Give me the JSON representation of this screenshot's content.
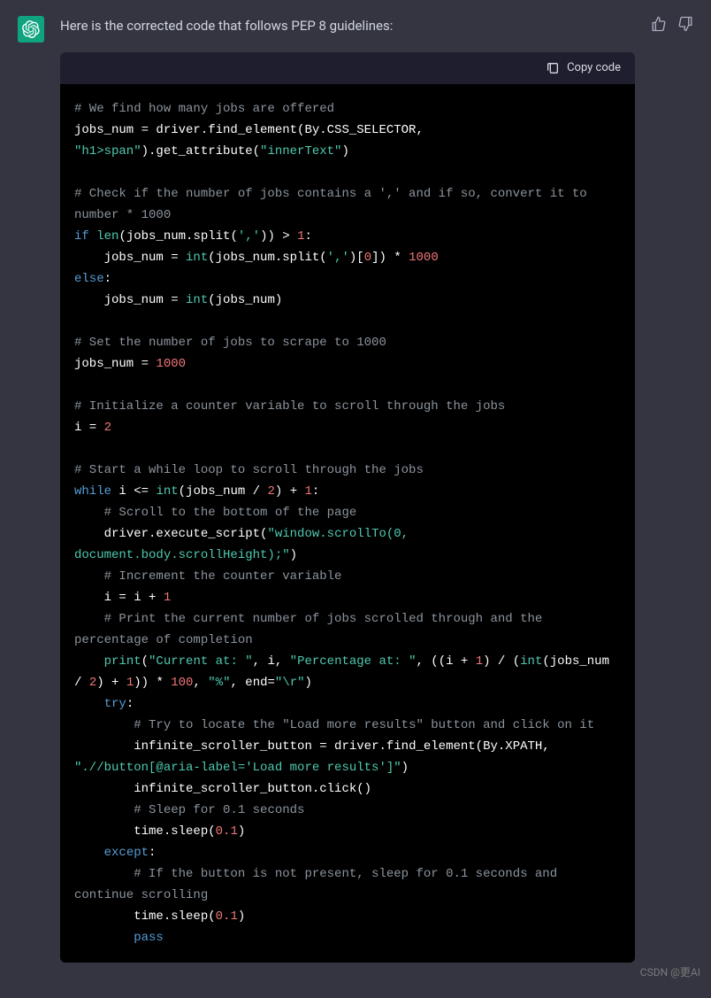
{
  "assistant_avatar": "openai-logo",
  "intro": "Here is the corrected code that follows PEP 8 guidelines:",
  "feedback": {
    "thumbs_up": "thumbs-up-icon",
    "thumbs_down": "thumbs-down-icon"
  },
  "code_toolbar": {
    "copy_label": "Copy code",
    "copy_icon": "clipboard-icon"
  },
  "code": {
    "tokens": [
      {
        "cls": "tok-comment",
        "t": "# We find how many jobs are offered"
      },
      {
        "cls": "nl",
        "t": "\n"
      },
      {
        "cls": "tok-ident",
        "t": "jobs_num = driver.find_element(By.CSS_SELECTOR, "
      },
      {
        "cls": "nl",
        "t": "\n"
      },
      {
        "cls": "tok-string",
        "t": "\"h1>span\""
      },
      {
        "cls": "tok-ident",
        "t": ").get_attribute("
      },
      {
        "cls": "tok-string",
        "t": "\"innerText\""
      },
      {
        "cls": "tok-ident",
        "t": ")"
      },
      {
        "cls": "nl",
        "t": "\n"
      },
      {
        "cls": "nl",
        "t": "\n"
      },
      {
        "cls": "tok-comment",
        "t": "# Check if the number of jobs contains a ',' and if so, convert it to number * 1000"
      },
      {
        "cls": "nl",
        "t": "\n"
      },
      {
        "cls": "tok-kw",
        "t": "if"
      },
      {
        "cls": "tok-ident",
        "t": " "
      },
      {
        "cls": "tok-builtin",
        "t": "len"
      },
      {
        "cls": "tok-ident",
        "t": "(jobs_num.split("
      },
      {
        "cls": "tok-string",
        "t": "','"
      },
      {
        "cls": "tok-ident",
        "t": ")) > "
      },
      {
        "cls": "tok-num",
        "t": "1"
      },
      {
        "cls": "tok-ident",
        "t": ":"
      },
      {
        "cls": "nl",
        "t": "\n"
      },
      {
        "cls": "tok-ident",
        "t": "    jobs_num = "
      },
      {
        "cls": "tok-builtin",
        "t": "int"
      },
      {
        "cls": "tok-ident",
        "t": "(jobs_num.split("
      },
      {
        "cls": "tok-string",
        "t": "','"
      },
      {
        "cls": "tok-ident",
        "t": ")["
      },
      {
        "cls": "tok-num",
        "t": "0"
      },
      {
        "cls": "tok-ident",
        "t": "]) * "
      },
      {
        "cls": "tok-num",
        "t": "1000"
      },
      {
        "cls": "nl",
        "t": "\n"
      },
      {
        "cls": "tok-kw",
        "t": "else"
      },
      {
        "cls": "tok-ident",
        "t": ":"
      },
      {
        "cls": "nl",
        "t": "\n"
      },
      {
        "cls": "tok-ident",
        "t": "    jobs_num = "
      },
      {
        "cls": "tok-builtin",
        "t": "int"
      },
      {
        "cls": "tok-ident",
        "t": "(jobs_num)"
      },
      {
        "cls": "nl",
        "t": "\n"
      },
      {
        "cls": "nl",
        "t": "\n"
      },
      {
        "cls": "tok-comment",
        "t": "# Set the number of jobs to scrape to 1000"
      },
      {
        "cls": "nl",
        "t": "\n"
      },
      {
        "cls": "tok-ident",
        "t": "jobs_num = "
      },
      {
        "cls": "tok-num",
        "t": "1000"
      },
      {
        "cls": "nl",
        "t": "\n"
      },
      {
        "cls": "nl",
        "t": "\n"
      },
      {
        "cls": "tok-comment",
        "t": "# Initialize a counter variable to scroll through the jobs"
      },
      {
        "cls": "nl",
        "t": "\n"
      },
      {
        "cls": "tok-ident",
        "t": "i = "
      },
      {
        "cls": "tok-num",
        "t": "2"
      },
      {
        "cls": "nl",
        "t": "\n"
      },
      {
        "cls": "nl",
        "t": "\n"
      },
      {
        "cls": "tok-comment",
        "t": "# Start a while loop to scroll through the jobs"
      },
      {
        "cls": "nl",
        "t": "\n"
      },
      {
        "cls": "tok-kw",
        "t": "while"
      },
      {
        "cls": "tok-ident",
        "t": " i <= "
      },
      {
        "cls": "tok-builtin",
        "t": "int"
      },
      {
        "cls": "tok-ident",
        "t": "(jobs_num / "
      },
      {
        "cls": "tok-num",
        "t": "2"
      },
      {
        "cls": "tok-ident",
        "t": ") + "
      },
      {
        "cls": "tok-num",
        "t": "1"
      },
      {
        "cls": "tok-ident",
        "t": ":"
      },
      {
        "cls": "nl",
        "t": "\n"
      },
      {
        "cls": "tok-ident",
        "t": "    "
      },
      {
        "cls": "tok-comment",
        "t": "# Scroll to the bottom of the page"
      },
      {
        "cls": "nl",
        "t": "\n"
      },
      {
        "cls": "tok-ident",
        "t": "    driver.execute_script("
      },
      {
        "cls": "tok-string",
        "t": "\"window.scrollTo(0, document.body.scrollHeight);\""
      },
      {
        "cls": "tok-ident",
        "t": ")"
      },
      {
        "cls": "nl",
        "t": "\n"
      },
      {
        "cls": "tok-ident",
        "t": "    "
      },
      {
        "cls": "tok-comment",
        "t": "# Increment the counter variable"
      },
      {
        "cls": "nl",
        "t": "\n"
      },
      {
        "cls": "tok-ident",
        "t": "    i = i + "
      },
      {
        "cls": "tok-num",
        "t": "1"
      },
      {
        "cls": "nl",
        "t": "\n"
      },
      {
        "cls": "tok-ident",
        "t": "    "
      },
      {
        "cls": "tok-comment",
        "t": "# Print the current number of jobs scrolled through and the percentage of completion"
      },
      {
        "cls": "nl",
        "t": "\n"
      },
      {
        "cls": "tok-ident",
        "t": "    "
      },
      {
        "cls": "tok-builtin",
        "t": "print"
      },
      {
        "cls": "tok-ident",
        "t": "("
      },
      {
        "cls": "tok-string",
        "t": "\"Current at: \""
      },
      {
        "cls": "tok-ident",
        "t": ", i, "
      },
      {
        "cls": "tok-string",
        "t": "\"Percentage at: \""
      },
      {
        "cls": "tok-ident",
        "t": ", ((i + "
      },
      {
        "cls": "tok-num",
        "t": "1"
      },
      {
        "cls": "tok-ident",
        "t": ") / ("
      },
      {
        "cls": "tok-builtin",
        "t": "int"
      },
      {
        "cls": "tok-ident",
        "t": "(jobs_num / "
      },
      {
        "cls": "tok-num",
        "t": "2"
      },
      {
        "cls": "tok-ident",
        "t": ") + "
      },
      {
        "cls": "tok-num",
        "t": "1"
      },
      {
        "cls": "tok-ident",
        "t": ")) * "
      },
      {
        "cls": "tok-num",
        "t": "100"
      },
      {
        "cls": "tok-ident",
        "t": ", "
      },
      {
        "cls": "tok-string",
        "t": "\"%\""
      },
      {
        "cls": "tok-ident",
        "t": ", end="
      },
      {
        "cls": "tok-string",
        "t": "\"\\r\""
      },
      {
        "cls": "tok-ident",
        "t": ")"
      },
      {
        "cls": "nl",
        "t": "\n"
      },
      {
        "cls": "tok-ident",
        "t": "    "
      },
      {
        "cls": "tok-kw",
        "t": "try"
      },
      {
        "cls": "tok-ident",
        "t": ":"
      },
      {
        "cls": "nl",
        "t": "\n"
      },
      {
        "cls": "tok-ident",
        "t": "        "
      },
      {
        "cls": "tok-comment",
        "t": "# Try to locate the \"Load more results\" button and click on it"
      },
      {
        "cls": "nl",
        "t": "\n"
      },
      {
        "cls": "tok-ident",
        "t": "        infinite_scroller_button = driver.find_element(By.XPATH, "
      },
      {
        "cls": "nl",
        "t": "\n"
      },
      {
        "cls": "tok-string",
        "t": "\".//button[@aria-label='Load more results']\""
      },
      {
        "cls": "tok-ident",
        "t": ")"
      },
      {
        "cls": "nl",
        "t": "\n"
      },
      {
        "cls": "tok-ident",
        "t": "        infinite_scroller_button.click()"
      },
      {
        "cls": "nl",
        "t": "\n"
      },
      {
        "cls": "tok-ident",
        "t": "        "
      },
      {
        "cls": "tok-comment",
        "t": "# Sleep for 0.1 seconds"
      },
      {
        "cls": "nl",
        "t": "\n"
      },
      {
        "cls": "tok-ident",
        "t": "        time.sleep("
      },
      {
        "cls": "tok-num",
        "t": "0.1"
      },
      {
        "cls": "tok-ident",
        "t": ")"
      },
      {
        "cls": "nl",
        "t": "\n"
      },
      {
        "cls": "tok-ident",
        "t": "    "
      },
      {
        "cls": "tok-kw",
        "t": "except"
      },
      {
        "cls": "tok-ident",
        "t": ":"
      },
      {
        "cls": "nl",
        "t": "\n"
      },
      {
        "cls": "tok-ident",
        "t": "        "
      },
      {
        "cls": "tok-comment",
        "t": "# If the button is not present, sleep for 0.1 seconds and continue scrolling"
      },
      {
        "cls": "nl",
        "t": "\n"
      },
      {
        "cls": "tok-ident",
        "t": "        time.sleep("
      },
      {
        "cls": "tok-num",
        "t": "0.1"
      },
      {
        "cls": "tok-ident",
        "t": ")"
      },
      {
        "cls": "nl",
        "t": "\n"
      },
      {
        "cls": "tok-ident",
        "t": "        "
      },
      {
        "cls": "tok-kw",
        "t": "pass"
      }
    ]
  },
  "watermark": "CSDN @更AI"
}
